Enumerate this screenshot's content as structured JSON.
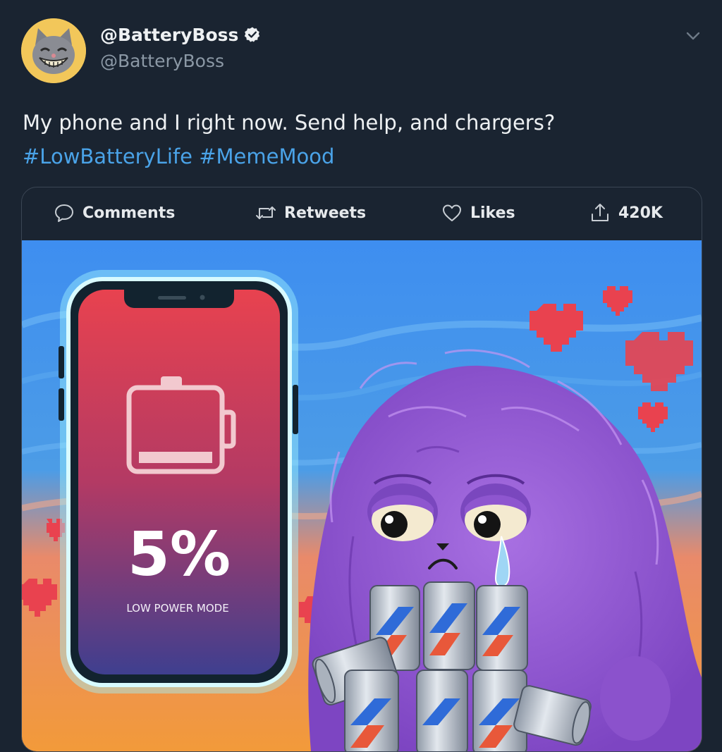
{
  "tweet": {
    "display_name": "@BatteryBoss",
    "handle": "@BatteryBoss",
    "text": "My phone and I right now. Send help, and chargers?",
    "hashtags": "#LowBatteryLife #MemeMood"
  },
  "actions": {
    "comments_label": "Comments",
    "retweets_label": "Retweets",
    "likes_label": "Likes",
    "share_count": "420K"
  },
  "media": {
    "battery_percent_text": "5%",
    "mode_label": "LOW POWER MODE",
    "battery_level": 0.05
  },
  "icons": [
    "verified-badge-icon",
    "chevron-down-icon",
    "comment-icon",
    "retweet-icon",
    "heart-icon",
    "share-icon",
    "battery-icon"
  ],
  "colors": {
    "background": "#1a2431",
    "hashtag": "#4aa3e8",
    "phone_screen_top": "#e8424f",
    "phone_screen_bottom": "#3f3f8f",
    "monster": "#9a5fd6"
  }
}
